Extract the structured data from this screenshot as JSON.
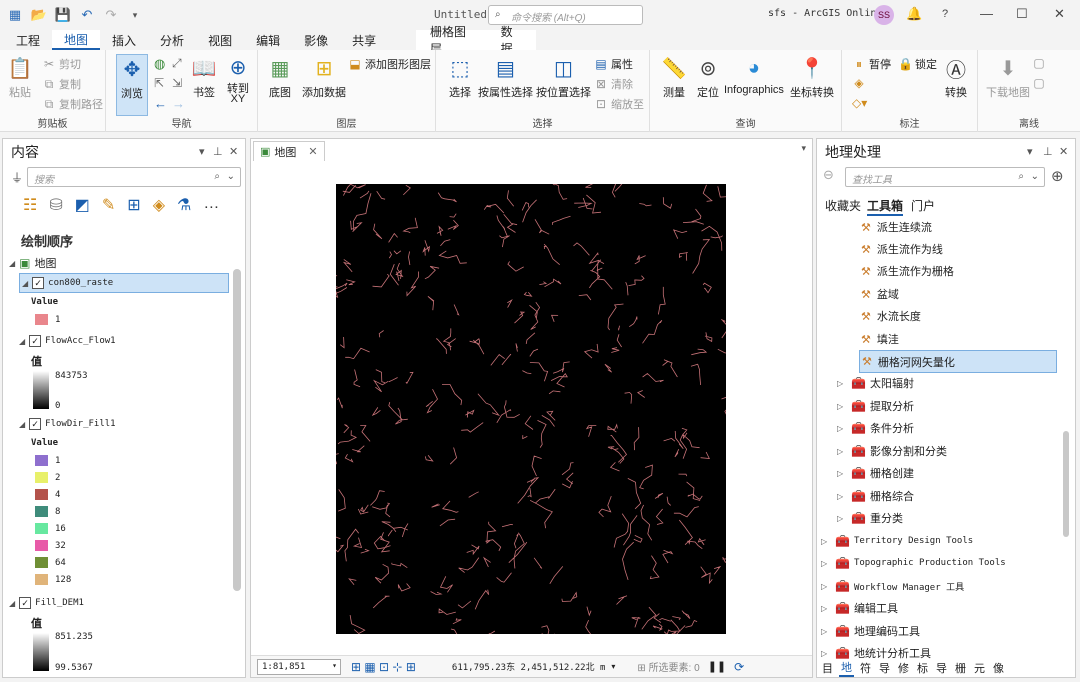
{
  "window": {
    "doc_title": "Untitled",
    "command_search_placeholder": "命令搜索 (Alt+Q)",
    "project": "sfs - ArcGIS Online",
    "user_initials": "SS"
  },
  "tabs": [
    "工程",
    "地图",
    "插入",
    "分析",
    "视图",
    "编辑",
    "影像",
    "共享"
  ],
  "context_tabs": [
    "栅格图层",
    "数据"
  ],
  "ribbon": {
    "clipboard": {
      "label": "剪贴板",
      "paste": "粘贴",
      "cut": "剪切",
      "copy": "复制",
      "copy_path": "复制路径"
    },
    "navigate": {
      "label": "导航",
      "explore": "浏览",
      "bookmarks": "书签",
      "goto": "转到\nXY"
    },
    "layer": {
      "label": "图层",
      "basemap": "底图",
      "add_data": "添加数据",
      "add_graphics": "添加图形图层"
    },
    "selection": {
      "label": "选择",
      "select": "选择",
      "by_attr": "按属性选择",
      "by_loc": "按位置选择",
      "attributes": "属性",
      "clear": "清除",
      "zoom_to": "缩放至"
    },
    "inquiry": {
      "label": "查询",
      "measure": "测量",
      "locate": "定位",
      "infographics": "Infographics",
      "coord_convert": "坐标转换"
    },
    "labeling": {
      "label": "标注",
      "pause": "暂停",
      "lock": "锁定",
      "convert": "转换"
    },
    "offline": {
      "label": "离线",
      "download": "下载地图"
    }
  },
  "contents": {
    "title": "内容",
    "search_placeholder": "搜索",
    "draw_order": "绘制顺序",
    "map_label": "地图",
    "layers": [
      {
        "name": "con800_raste",
        "legend_title": "Value",
        "items": [
          {
            "label": "1",
            "color": "#e9868c"
          }
        ]
      },
      {
        "name": "FlowAcc_Flow1",
        "legend_title": "值",
        "high": "843753",
        "low": "0"
      },
      {
        "name": "FlowDir_Fill1",
        "legend_title": "Value",
        "items": [
          {
            "label": "1",
            "color": "#8e6fce"
          },
          {
            "label": "2",
            "color": "#e8f06a"
          },
          {
            "label": "4",
            "color": "#b4534b"
          },
          {
            "label": "8",
            "color": "#3f8c7b"
          },
          {
            "label": "16",
            "color": "#67e8a0"
          },
          {
            "label": "32",
            "color": "#e85aa8"
          },
          {
            "label": "64",
            "color": "#6f8f35"
          },
          {
            "label": "128",
            "color": "#e0b47a"
          }
        ]
      },
      {
        "name": "Fill_DEM1",
        "legend_title": "值",
        "high": "851.235",
        "low": "99.5367"
      }
    ]
  },
  "map": {
    "tab": "地图",
    "scale": "1:81,851",
    "coords": "611,795.23东 2,451,512.22北 m",
    "selected": "所选要素: 0"
  },
  "geoprocessing": {
    "title": "地理处理",
    "search_placeholder": "查找工具",
    "sub_tabs": [
      "收藏夹",
      "工具箱",
      "门户"
    ],
    "tools": [
      "派生连续流",
      "派生流作为线",
      "派生流作为栅格",
      "盆域",
      "水流长度",
      "填洼",
      "栅格河网矢量化"
    ],
    "toolsets": [
      "太阳辐射",
      "提取分析",
      "条件分析",
      "影像分割和分类",
      "栅格创建",
      "栅格综合",
      "重分类"
    ],
    "toolboxes": [
      "Territory Design Tools",
      "Topographic Production Tools",
      "Workflow Manager 工具",
      "编辑工具",
      "地理编码工具",
      "地统计分析工具"
    ]
  },
  "bottom_tabs": [
    "目",
    "地",
    "符",
    "导",
    "修",
    "标",
    "导",
    "栅",
    "元",
    "像"
  ]
}
